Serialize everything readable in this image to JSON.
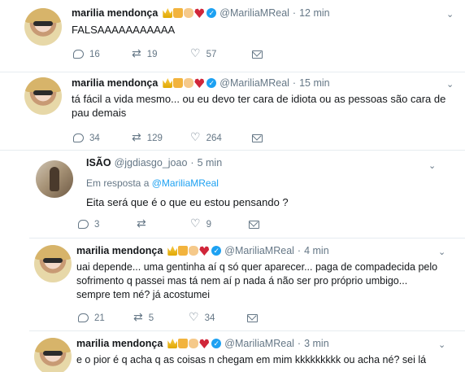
{
  "tweets": [
    {
      "name": "marilia mendonça",
      "handle": "@MariliaMReal",
      "dot": "·",
      "time": "12 min",
      "text": "FALSAAAAAAAAAAA",
      "reply_count": "16",
      "retweet_count": "19",
      "like_count": "57"
    },
    {
      "name": "marilia mendonça",
      "handle": "@MariliaMReal",
      "dot": "·",
      "time": "15 min",
      "text_line1": "tá fácil a vida mesmo... ou eu devo ter cara de idiota ou as pessoas são cara de",
      "text_line2": "pau demais",
      "reply_count": "34",
      "retweet_count": "129",
      "like_count": "264"
    },
    {
      "name": "ISÃO",
      "handle": "@jgdiasgo_joao",
      "dot": "·",
      "time": "5 min",
      "reply_prefix": "Em resposta a",
      "reply_mention": "@MariliaMReal",
      "text": "Eita será que é o que eu estou pensando ?",
      "reply_count": "3",
      "retweet_count": "",
      "like_count": "9"
    },
    {
      "name": "marilia mendonça",
      "handle": "@MariliaMReal",
      "dot": "·",
      "time": "4 min",
      "text_line1": "uai depende... uma gentinha aí q só quer aparecer... paga de compadecida pelo",
      "text_line2": "sofrimento q passei mas tá nem aí p nada á não ser pro próprio umbigo...",
      "text_line3": "sempre tem né? já acostumei",
      "reply_count": "21",
      "retweet_count": "5",
      "like_count": "34"
    },
    {
      "name": "marilia mendonça",
      "handle": "@MariliaMReal",
      "dot": "·",
      "time": "3 min",
      "text": "e o pior é q acha q as coisas n chegam em mim kkkkkkkkk ou acha né? sei lá"
    }
  ],
  "icons": {
    "reply": "reply-icon",
    "retweet": "retweet-icon",
    "like": "heart-icon",
    "message": "envelope-icon",
    "more": "chevron-down-icon",
    "verified": "verified-badge-icon"
  },
  "colors": {
    "accent": "#1da1f2",
    "muted": "#657786",
    "text": "#14171a",
    "divider": "#e6ecf0"
  }
}
